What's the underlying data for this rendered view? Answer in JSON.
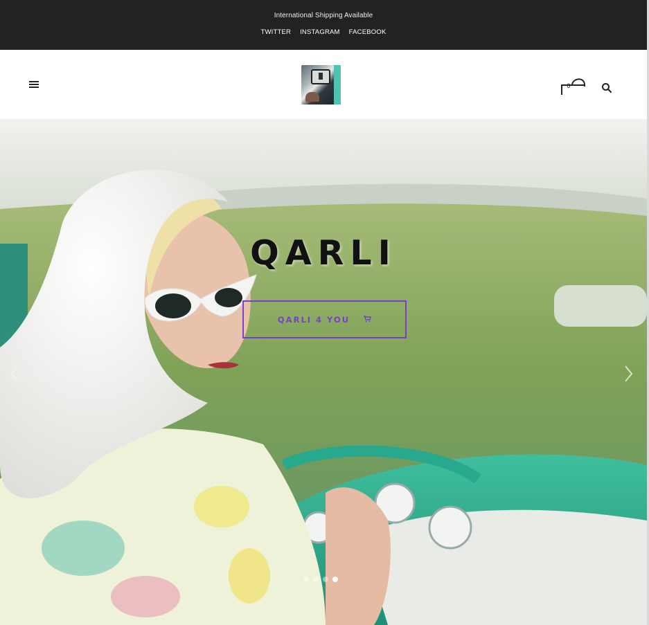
{
  "topbar": {
    "notice": "International Shipping Available",
    "social": [
      "TWITTER",
      "INSTAGRAM",
      "FACEBOOK"
    ]
  },
  "header": {
    "menu_icon": "hamburger-icon",
    "logo_alt": "QARLI",
    "cart_count": "0",
    "cart_icon": "cart-icon",
    "search_icon": "search-icon"
  },
  "hero": {
    "headline": "QARLI",
    "cta_label": "QARLI 4 YOU",
    "cta_icon": "cart-icon",
    "next_icon": "chevron-right-icon",
    "prev_icon": "chevron-left-icon",
    "slides_total": 4,
    "active_slide": 4
  },
  "colors": {
    "topbar_bg": "#222222",
    "accent": "#7a3fc9",
    "text": "#111111"
  }
}
